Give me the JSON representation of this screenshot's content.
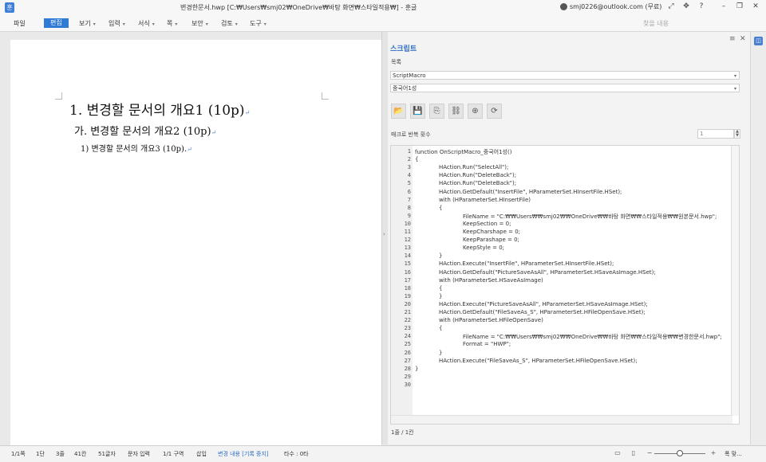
{
  "window": {
    "title": "변경한문서.hwp [C:₩Users₩smj02₩OneDrive₩바탕 화면₩스타일적용₩] - 훈글",
    "account": "smj0226@outlook.com (무료)",
    "controls": [
      "⤢",
      "✥",
      "?",
      "–",
      "❐",
      "✕"
    ]
  },
  "menubar": {
    "items": [
      {
        "label": "파일",
        "dropdown": false
      },
      {
        "label": "편집",
        "dropdown": false,
        "active": true
      },
      {
        "label": "보기",
        "dropdown": true
      },
      {
        "label": "입력",
        "dropdown": true
      },
      {
        "label": "서식",
        "dropdown": true
      },
      {
        "label": "쪽",
        "dropdown": true
      },
      {
        "label": "보안",
        "dropdown": true
      },
      {
        "label": "검토",
        "dropdown": true
      },
      {
        "label": "도구",
        "dropdown": true
      }
    ],
    "search_placeholder": "찾을 내용"
  },
  "document": {
    "heading1": "1. 변경할 문서의 개요1 (10p)",
    "heading2": "가. 변경할 문서의 개요2 (10p)",
    "heading3": "1) 변경할 문서의 개요3 (10p).",
    "para_mark": "↵"
  },
  "script_panel": {
    "title": "스크립트",
    "list_label": "목록",
    "macro_select": "ScriptMacro",
    "sub_select": "중국어1성",
    "repeat_label": "매크로 반복 횟수",
    "repeat_value": "1",
    "status": "1줄 / 1칸",
    "toolbar": [
      {
        "icon": "open-folder-icon",
        "glyph": "📂"
      },
      {
        "icon": "save-icon",
        "glyph": "💾"
      },
      {
        "icon": "save-as-icon",
        "glyph": "⎘"
      },
      {
        "icon": "link-icon",
        "glyph": "⛓"
      },
      {
        "icon": "add-icon",
        "glyph": "⊕"
      },
      {
        "icon": "refresh-icon",
        "glyph": "⟳"
      }
    ],
    "code_lines": [
      {
        "n": "1",
        "indent": 0,
        "text": "function OnScriptMacro_중국어1성()"
      },
      {
        "n": "2",
        "indent": 0,
        "text": "{"
      },
      {
        "n": "3",
        "indent": 1,
        "text": "HAction.Run(\"SelectAll\");"
      },
      {
        "n": "4",
        "indent": 1,
        "text": "HAction.Run(\"DeleteBack\");"
      },
      {
        "n": "5",
        "indent": 1,
        "text": "HAction.Run(\"DeleteBack\");"
      },
      {
        "n": "6",
        "indent": 1,
        "text": "HAction.GetDefault(\"InsertFile\", HParameterSet.HInsertFile.HSet);"
      },
      {
        "n": "7",
        "indent": 1,
        "text": "with (HParameterSet.HInsertFile)"
      },
      {
        "n": "8",
        "indent": 1,
        "text": "{"
      },
      {
        "n": "9",
        "indent": 2,
        "text": "FileName = \"C:₩₩Users₩₩smj02₩₩OneDrive₩₩바탕 화면₩₩스타일적용₩₩원본문서.hwp\";"
      },
      {
        "n": "10",
        "indent": 2,
        "text": "KeepSection = 0;"
      },
      {
        "n": "11",
        "indent": 2,
        "text": "KeepCharshape = 0;"
      },
      {
        "n": "12",
        "indent": 2,
        "text": "KeepParashape = 0;"
      },
      {
        "n": "13",
        "indent": 2,
        "text": "KeepStyle = 0;"
      },
      {
        "n": "14",
        "indent": 1,
        "text": "}"
      },
      {
        "n": "15",
        "indent": 1,
        "text": "HAction.Execute(\"InsertFile\", HParameterSet.HInsertFile.HSet);"
      },
      {
        "n": "16",
        "indent": 1,
        "text": "HAction.GetDefault(\"PictureSaveAsAll\", HParameterSet.HSaveAsImage.HSet);"
      },
      {
        "n": "17",
        "indent": 1,
        "text": "with (HParameterSet.HSaveAsImage)"
      },
      {
        "n": "18",
        "indent": 1,
        "text": "{"
      },
      {
        "n": "19",
        "indent": 1,
        "text": "}"
      },
      {
        "n": "20",
        "indent": 1,
        "text": "HAction.Execute(\"PictureSaveAsAll\", HParameterSet.HSaveAsImage.HSet);"
      },
      {
        "n": "21",
        "indent": 1,
        "text": "HAction.GetDefault(\"FileSaveAs_S\", HParameterSet.HFileOpenSave.HSet);"
      },
      {
        "n": "22",
        "indent": 1,
        "text": "with (HParameterSet.HFileOpenSave)"
      },
      {
        "n": "23",
        "indent": 1,
        "text": "{"
      },
      {
        "n": "24",
        "indent": 2,
        "text": "FileName = \"C:₩₩Users₩₩smj02₩₩OneDrive₩₩바탕 화면₩₩스타일적용₩₩변경한문서.hwp\";"
      },
      {
        "n": "25",
        "indent": 2,
        "text": "Format = \"HWP\";"
      },
      {
        "n": "26",
        "indent": 1,
        "text": "}"
      },
      {
        "n": "27",
        "indent": 1,
        "text": "HAction.Execute(\"FileSaveAs_S\", HParameterSet.HFileOpenSave.HSet);"
      },
      {
        "n": "28",
        "indent": 0,
        "text": "}"
      },
      {
        "n": "29",
        "indent": 0,
        "text": ""
      },
      {
        "n": "30",
        "indent": 0,
        "text": ""
      }
    ]
  },
  "statusbar": {
    "items": [
      {
        "label": "1/1쪽",
        "hl": false
      },
      {
        "label": "1단",
        "hl": false
      },
      {
        "label": "3줄",
        "hl": false
      },
      {
        "label": "41칸",
        "hl": false
      },
      {
        "label": "51글자",
        "hl": false
      },
      {
        "label": "문자 입력",
        "hl": false
      },
      {
        "label": "1/1 구역",
        "hl": false
      },
      {
        "label": "삽입",
        "hl": false
      },
      {
        "label": "변경 내용 [기록 중지]",
        "hl": true
      },
      {
        "label": "타수 : 0타",
        "hl": false
      }
    ],
    "zoom_label": "폭 맞..."
  }
}
